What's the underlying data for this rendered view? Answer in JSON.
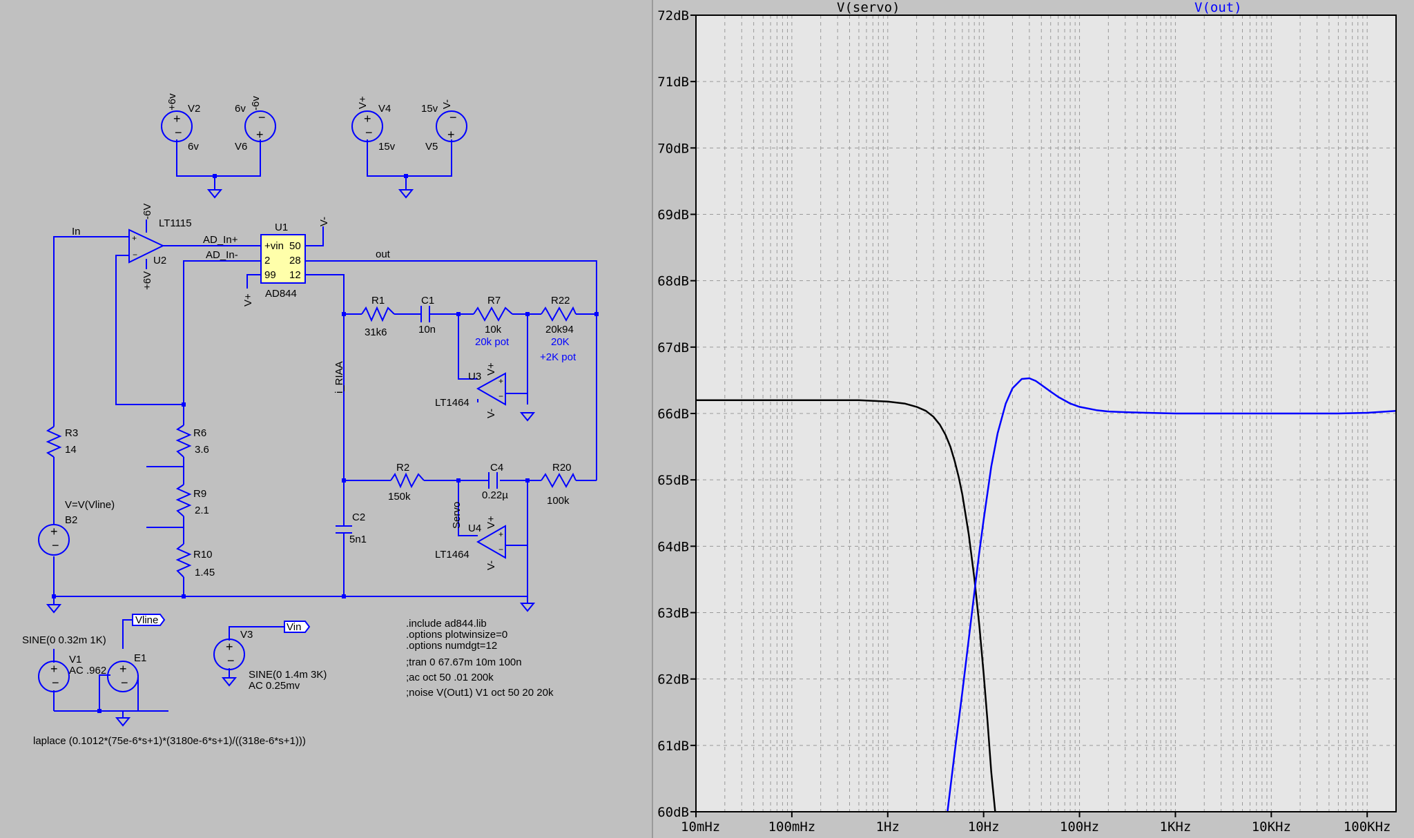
{
  "schematic": {
    "supplies": {
      "v2": {
        "ref": "V2",
        "value": "6v",
        "node": "+6v"
      },
      "v6": {
        "ref": "V6",
        "value": "6v",
        "node": "-6v"
      },
      "v4": {
        "ref": "V4",
        "value": "15v",
        "node": "V+"
      },
      "v5": {
        "ref": "V5",
        "value": "15v",
        "node": "V-"
      }
    },
    "opamp_u2": {
      "ref": "U2",
      "part": "LT1115",
      "neg_supply": "-6V",
      "pos_supply": "+6V"
    },
    "ic_u1": {
      "ref": "U1",
      "part": "AD844",
      "pin_rows": [
        {
          "left": "+vin",
          "right": "50"
        },
        {
          "left": "2",
          "right": "28"
        },
        {
          "left": "99",
          "right": "12"
        }
      ],
      "supply_top": "V-",
      "supply_bottom": "V+"
    },
    "nets": {
      "in": "In",
      "ad_in_plus": "AD_In+",
      "ad_in_minus": "AD_In-",
      "out": "out",
      "i_riaa": "i_RIAA",
      "servo": "Servo"
    },
    "components": {
      "r1": {
        "ref": "R1",
        "value": "31k6"
      },
      "c1": {
        "ref": "C1",
        "value": "10n"
      },
      "r7": {
        "ref": "R7",
        "value": "10k",
        "note": "20k pot"
      },
      "r22": {
        "ref": "R22",
        "value": "20k94",
        "note1": "20K",
        "note2": "+2K pot"
      },
      "r3": {
        "ref": "R3",
        "value": "14"
      },
      "r6": {
        "ref": "R6",
        "value": "3.6"
      },
      "r9": {
        "ref": "R9",
        "value": "2.1"
      },
      "r10": {
        "ref": "R10",
        "value": "1.45"
      },
      "r2": {
        "ref": "R2",
        "value": "150k"
      },
      "c4": {
        "ref": "C4",
        "value": "0.22µ"
      },
      "r20": {
        "ref": "R20",
        "value": "100k"
      },
      "c2": {
        "ref": "C2",
        "value": "5n1"
      },
      "b2": {
        "ref": "B2",
        "expr": "V=V(Vline)"
      },
      "u3": {
        "ref": "U3",
        "part": "LT1464",
        "pos": "V+",
        "neg": "V-"
      },
      "u4": {
        "ref": "U4",
        "part": "LT1464",
        "pos": "V+",
        "neg": "V-"
      }
    },
    "sources": {
      "v1": {
        "ref": "V1",
        "sine": "SINE(0 0.32m 1K)",
        "ac": "AC .962"
      },
      "e1": {
        "ref": "E1",
        "label": "Vline"
      },
      "v3": {
        "ref": "V3",
        "label": "Vin",
        "sine": "SINE(0 1.4m 3K)",
        "ac": "AC 0.25mv"
      },
      "laplace": "laplace (0.1012*(75e-6*s+1)*(3180e-6*s+1)/((318e-6*s+1)))"
    },
    "directives": [
      ".include ad844.lib",
      ".options plotwinsize=0",
      ".options numdgt=12",
      ";tran 0 67.67m 10m 100n",
      ";ac oct 50 .01 200k",
      ";noise V(Out1) V1 oct 50 20 20k"
    ],
    "colors": {
      "wire": "#0000ff",
      "ic_fill": "#ffffaa",
      "background": "#c0c0c0"
    }
  },
  "plot": {
    "trace_labels": {
      "servo": "V(servo)",
      "out": "V(out)"
    },
    "colors": {
      "servo": "#000000",
      "out": "#0000ff",
      "background": "#e6e6e6",
      "grid": "#999999"
    }
  },
  "chart_data": {
    "type": "line",
    "x_scale": "log",
    "xlim": [
      0.01,
      200000
    ],
    "ylim": [
      60,
      72
    ],
    "x_ticks": [
      {
        "value": 0.01,
        "label": "10mHz"
      },
      {
        "value": 0.1,
        "label": "100mHz"
      },
      {
        "value": 1,
        "label": "1Hz"
      },
      {
        "value": 10,
        "label": "10Hz"
      },
      {
        "value": 100,
        "label": "100Hz"
      },
      {
        "value": 1000,
        "label": "1KHz"
      },
      {
        "value": 10000,
        "label": "10KHz"
      },
      {
        "value": 100000,
        "label": "100KHz"
      }
    ],
    "y_ticks": [
      {
        "value": 60,
        "label": "60dB"
      },
      {
        "value": 61,
        "label": "61dB"
      },
      {
        "value": 62,
        "label": "62dB"
      },
      {
        "value": 63,
        "label": "63dB"
      },
      {
        "value": 64,
        "label": "64dB"
      },
      {
        "value": 65,
        "label": "65dB"
      },
      {
        "value": 66,
        "label": "66dB"
      },
      {
        "value": 67,
        "label": "67dB"
      },
      {
        "value": 68,
        "label": "68dB"
      },
      {
        "value": 69,
        "label": "69dB"
      },
      {
        "value": 70,
        "label": "70dB"
      },
      {
        "value": 71,
        "label": "71dB"
      },
      {
        "value": 72,
        "label": "72dB"
      }
    ],
    "grid": true,
    "series": [
      {
        "name": "V(servo)",
        "color": "#000000",
        "x": [
          0.01,
          0.05,
          0.1,
          0.3,
          0.5,
          1,
          1.5,
          2,
          2.5,
          3,
          3.5,
          4,
          4.5,
          5,
          5.5,
          6,
          7,
          8,
          9,
          10,
          11,
          12,
          13.2
        ],
        "y": [
          66.2,
          66.2,
          66.2,
          66.2,
          66.2,
          66.18,
          66.15,
          66.1,
          66.04,
          65.95,
          65.83,
          65.68,
          65.5,
          65.28,
          65.04,
          64.78,
          64.18,
          63.52,
          62.82,
          62.08,
          61.35,
          60.6,
          60.0
        ]
      },
      {
        "name": "V(out)",
        "color": "#0000ff",
        "x": [
          4.2,
          5,
          6,
          7,
          8,
          9,
          10,
          12,
          14,
          17,
          20,
          25,
          30,
          35,
          40,
          50,
          60,
          80,
          100,
          150,
          200,
          300,
          500,
          1000,
          2000,
          5000,
          10000,
          20000,
          50000,
          100000,
          200000
        ],
        "y": [
          60.0,
          60.9,
          61.8,
          62.6,
          63.3,
          63.9,
          64.4,
          65.2,
          65.7,
          66.15,
          66.38,
          66.52,
          66.53,
          66.49,
          66.43,
          66.33,
          66.25,
          66.15,
          66.1,
          66.05,
          66.03,
          66.02,
          66.01,
          66.0,
          66.0,
          66.0,
          66.0,
          66.0,
          66.0,
          66.01,
          66.04
        ]
      }
    ]
  }
}
